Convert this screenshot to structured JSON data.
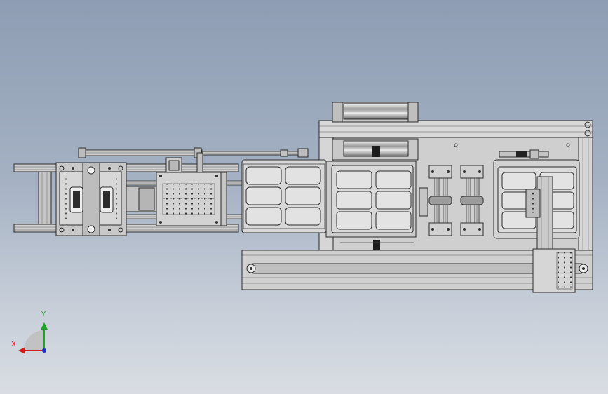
{
  "viewport": {
    "background_top": "#8e9db3",
    "background_bottom": "#d9dde3"
  },
  "model": {
    "edge_color": "#2b2b2b",
    "body_color": "#d4d4d4",
    "steel_color": "#bdbdbd"
  },
  "triad": {
    "x_label": "X",
    "y_label": "Y",
    "x_color": "#d21a1a",
    "y_color": "#1fa12a",
    "z_color": "#1a2fbf"
  }
}
